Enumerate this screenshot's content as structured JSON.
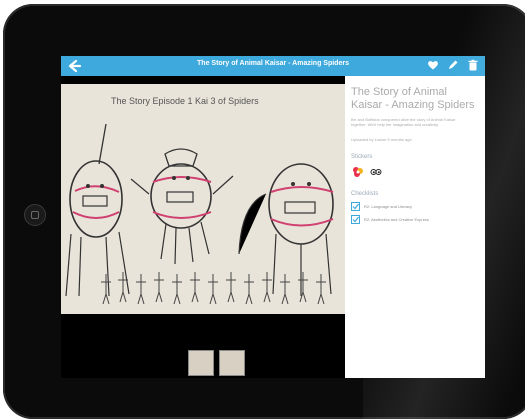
{
  "topbar": {
    "title": "The Story of Animal Kaisar - Amazing Spiders",
    "icons": [
      "back-arrow-icon",
      "heart-icon",
      "pencil-icon",
      "trash-icon"
    ]
  },
  "artwork": {
    "caption": "The Story Episode 1 Kai 3 of Spiders"
  },
  "panel": {
    "title": "The Story of Animal Kaisar - Amazing Spiders",
    "description": "Brr and Buffalos conquered alive the story of Animal Kaisar together. We'll help her imagination and creativity.",
    "uploaded": "Uploaded by Louise 5 months ago",
    "stickers_heading": "Stickers",
    "stickers": [
      "flower-sticker-icon",
      "eyes-sticker-icon"
    ],
    "checklists_heading": "Checklists",
    "checklists": [
      "R2: Language and Literacy",
      "R2: Aesthetics and Creative Express"
    ]
  },
  "colors": {
    "accent": "#3da9dc",
    "bezel": "#0b0b0b"
  }
}
